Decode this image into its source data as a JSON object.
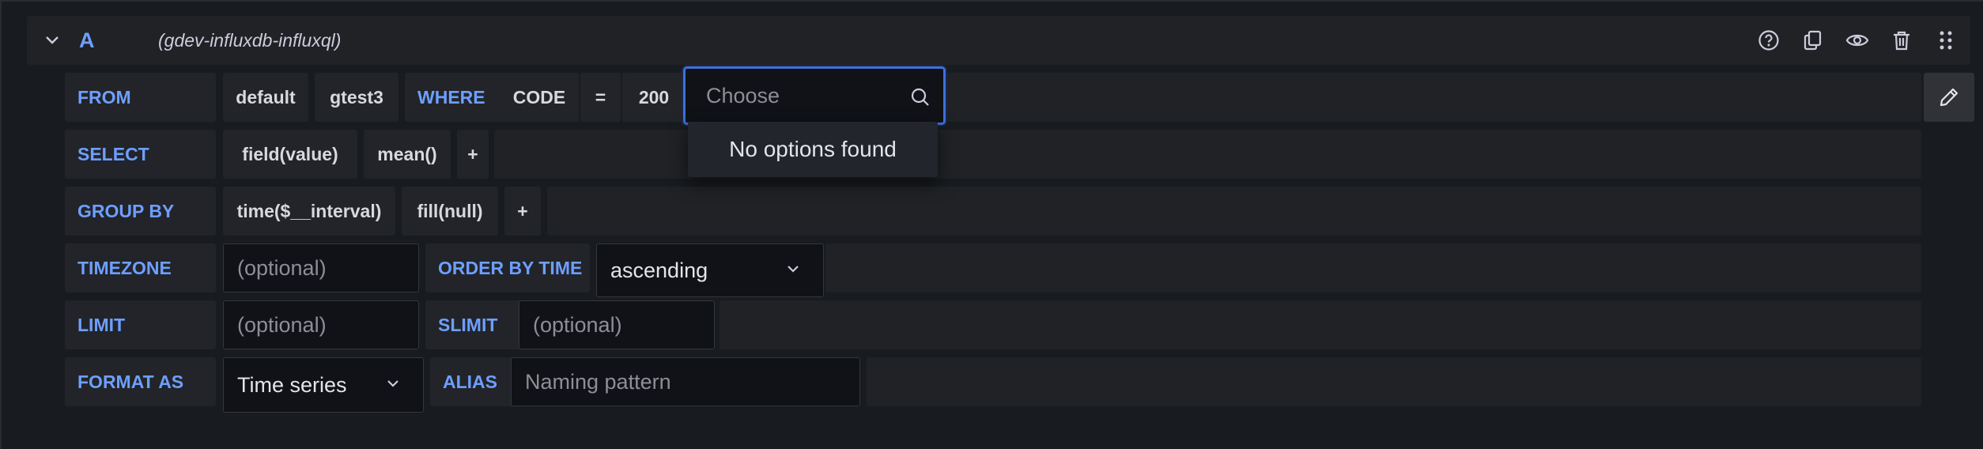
{
  "query": {
    "ref_id": "A",
    "datasource": "(gdev-influxdb-influxql)",
    "header_icons": [
      "help-icon",
      "duplicate-icon",
      "eye-icon",
      "trash-icon",
      "drag-handle-icon"
    ]
  },
  "from_row": {
    "label": "FROM",
    "policy": "default",
    "measurement": "gtest3",
    "where_label": "WHERE",
    "tag_key": "CODE",
    "operator": "=",
    "tag_value": "200",
    "choose_placeholder": "Choose",
    "dropdown_message": "No options found"
  },
  "select_row": {
    "label": "SELECT",
    "field": "field(value)",
    "aggregation": "mean()",
    "add": "+"
  },
  "groupby_row": {
    "label": "GROUP BY",
    "time": "time($__interval)",
    "fill": "fill(null)",
    "add": "+"
  },
  "timezone_row": {
    "label": "TIMEZONE",
    "timezone_placeholder": "(optional)",
    "order_label": "ORDER BY TIME",
    "order_value": "ascending"
  },
  "limit_row": {
    "label": "LIMIT",
    "limit_placeholder": "(optional)",
    "slimit_label": "SLIMIT",
    "slimit_placeholder": "(optional)"
  },
  "format_row": {
    "label": "FORMAT AS",
    "format_value": "Time series",
    "alias_label": "ALIAS",
    "alias_placeholder": "Naming pattern"
  },
  "colors": {
    "keyword": "#6e9fff",
    "focus_border": "#3d71d9",
    "background": "#181b1f",
    "panel": "#202226"
  }
}
